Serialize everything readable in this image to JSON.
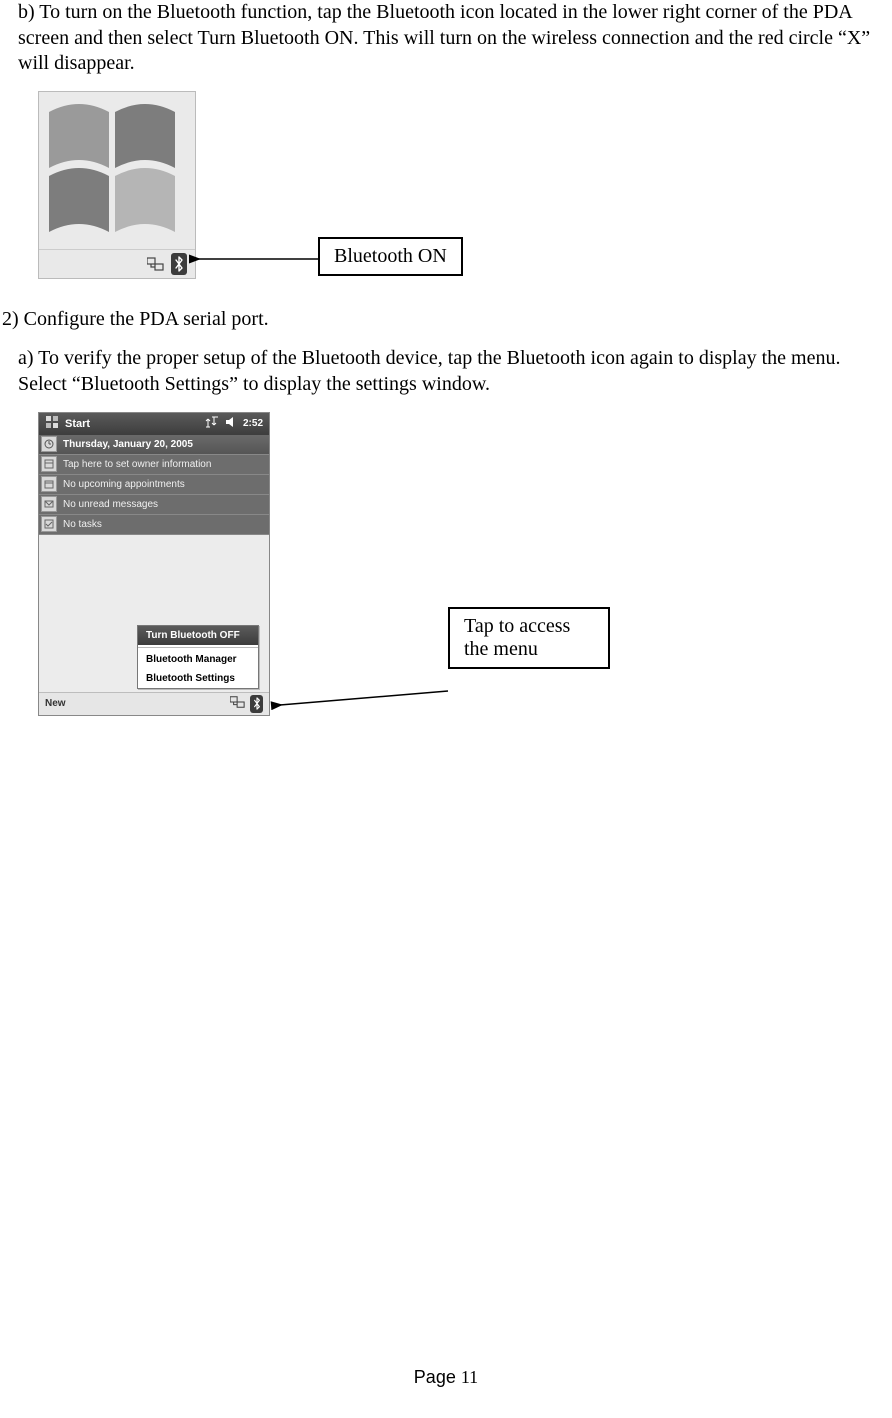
{
  "para_b": "b) To turn on the Bluetooth function, tap the Bluetooth icon located in the lower right corner of the PDA screen and then select Turn Bluetooth ON. This will turn on the wireless connection and the red circle “X” will disappear.",
  "callout1": "Bluetooth ON",
  "step2": "2) Configure the PDA serial port.",
  "para_a": "a) To verify the proper setup of the Bluetooth device, tap the Bluetooth icon again to display the menu. Select “Bluetooth Settings” to display the settings window.",
  "callout2": "Tap to access the menu",
  "footer": {
    "label": "Page ",
    "num": "11"
  },
  "pda": {
    "title": "Start",
    "time": "2:52",
    "date": "Thursday, January 20, 2005",
    "owner": "Tap here to set owner information",
    "appts": "No upcoming appointments",
    "msgs": "No unread messages",
    "tasks": "No tasks",
    "menu": {
      "off": "Turn Bluetooth OFF",
      "mgr": "Bluetooth Manager",
      "set": "Bluetooth Settings"
    },
    "new": "New"
  }
}
